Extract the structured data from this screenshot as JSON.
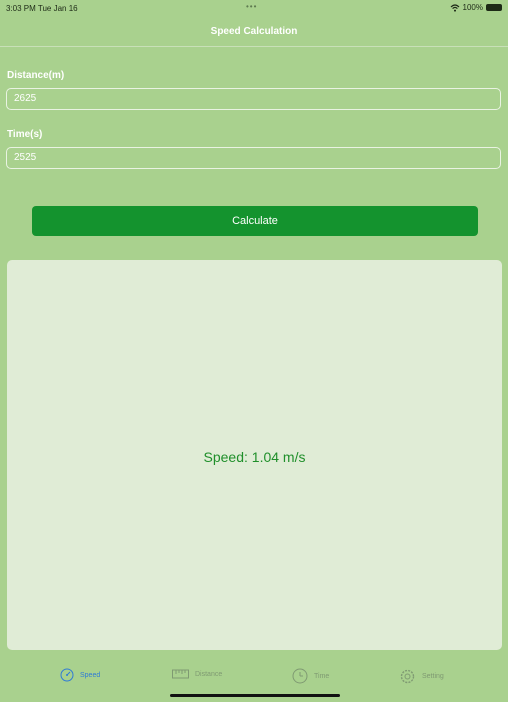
{
  "status_bar": {
    "time": "3:03 PM  Tue Jan 16",
    "dots": "•••",
    "battery_text": "100%"
  },
  "nav": {
    "title": "Speed Calculation"
  },
  "form": {
    "distance_label": "Distance(m)",
    "distance_value": "2625",
    "time_label": "Time(s)",
    "time_value": "2525"
  },
  "calculate_label": "Calculate",
  "result": {
    "text": "Speed: 1.04 m/s"
  },
  "tabs": [
    {
      "label": "Speed",
      "icon": "speedometer-icon",
      "active": true
    },
    {
      "label": "Distance",
      "icon": "ruler-icon",
      "active": false
    },
    {
      "label": "Time",
      "icon": "clock-icon",
      "active": false
    },
    {
      "label": "Setting",
      "icon": "gear-icon",
      "active": false
    }
  ],
  "colors": {
    "background": "#a9d18e",
    "button": "#14932e",
    "result_text": "#1f8f2a",
    "tab_active": "#2f7bd6",
    "tab_inactive": "#7f9a72"
  }
}
